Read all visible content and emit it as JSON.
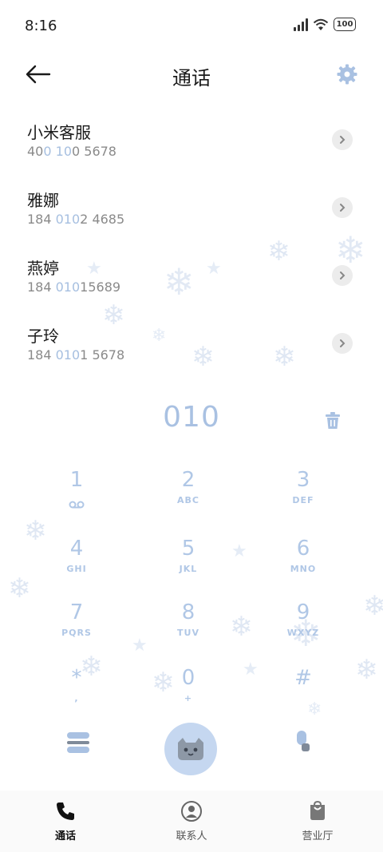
{
  "status_bar": {
    "time": "8:16",
    "battery": "100"
  },
  "header": {
    "title": "通话"
  },
  "contacts": [
    {
      "name": "小米客服",
      "number_parts": [
        "40",
        "0",
        " ",
        "10",
        "0 5678"
      ]
    },
    {
      "name": "雅娜",
      "number_parts": [
        "184 ",
        "010",
        "2 4685"
      ]
    },
    {
      "name": "燕婷",
      "number_parts": [
        "184 ",
        "010",
        "15689"
      ]
    },
    {
      "name": "子玲",
      "number_parts": [
        "184 ",
        "010",
        "1 5678"
      ]
    }
  ],
  "dialer": {
    "input": "010",
    "keys": [
      {
        "digit": "1",
        "letters": ""
      },
      {
        "digit": "2",
        "letters": "ABC"
      },
      {
        "digit": "3",
        "letters": "DEF"
      },
      {
        "digit": "4",
        "letters": "GHI"
      },
      {
        "digit": "5",
        "letters": "JKL"
      },
      {
        "digit": "6",
        "letters": "MNO"
      },
      {
        "digit": "7",
        "letters": "PQRS"
      },
      {
        "digit": "8",
        "letters": "TUV"
      },
      {
        "digit": "9",
        "letters": "WXYZ"
      },
      {
        "digit": "*",
        "letters": ","
      },
      {
        "digit": "0",
        "letters": "+"
      },
      {
        "digit": "#",
        "letters": ""
      }
    ]
  },
  "bottom_nav": [
    {
      "label": "通话",
      "icon": "phone-icon",
      "active": true
    },
    {
      "label": "联系人",
      "icon": "contact-icon",
      "active": false
    },
    {
      "label": "营业厅",
      "icon": "store-bag-icon",
      "active": false
    }
  ],
  "colors": {
    "accent": "#a9c1e2",
    "call_button": "#c5d7f0",
    "text": "#1a1a1a",
    "secondary_text": "#8a8a8a"
  }
}
